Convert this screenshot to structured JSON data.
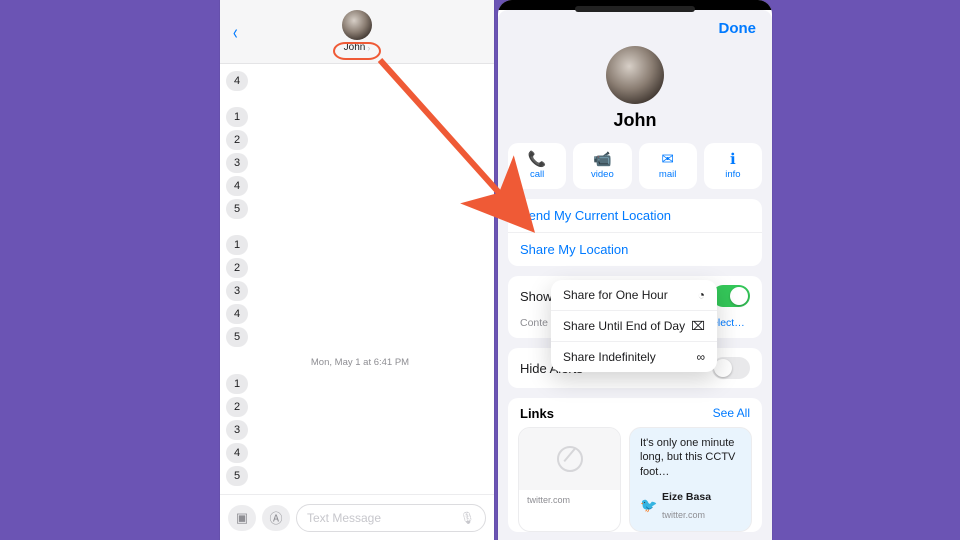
{
  "colors": {
    "accent": "#007aff",
    "annotation": "#ef5a36",
    "toggle_on": "#34c759"
  },
  "left": {
    "contact_name": "John",
    "back_label": "Back",
    "composer_placeholder": "Text Message",
    "timestamp": "Mon, May 1 at 6:41 PM",
    "bubble_groups": [
      [
        "4"
      ],
      [
        "1",
        "2",
        "3",
        "4",
        "5"
      ],
      [
        "1",
        "2",
        "3",
        "4",
        "5"
      ]
    ],
    "bubble_group_after_timestamp": [
      "1",
      "2",
      "3",
      "4",
      "5"
    ]
  },
  "right": {
    "done_label": "Done",
    "contact_name": "John",
    "actions": [
      {
        "id": "call",
        "label": "call",
        "glyph": "📞"
      },
      {
        "id": "video",
        "label": "video",
        "glyph": "📹"
      },
      {
        "id": "mail",
        "label": "mail",
        "glyph": "✉︎"
      },
      {
        "id": "info",
        "label": "info",
        "glyph": "ℹ︎"
      }
    ],
    "location_rows": {
      "send_current": "Send My Current Location",
      "share_my": "Share My Location"
    },
    "show_in_shared": {
      "title_visible_prefix": "Show",
      "description_prefix": "Conte",
      "description_suffix": "n",
      "select_link_suffix": "select…",
      "toggle_on": true
    },
    "hide_alerts": {
      "label": "Hide Alerts",
      "toggle_on": false
    },
    "share_popover": [
      {
        "label": "Share for One Hour",
        "icon": "◔"
      },
      {
        "label": "Share Until End of Day",
        "icon": "⌧"
      },
      {
        "label": "Share Indefinitely",
        "icon": "∞"
      }
    ],
    "links": {
      "header": "Links",
      "see_all": "See All",
      "ghost_source": "twitter.com",
      "tweet_text": "It's only one minute long, but this CCTV foot…",
      "tweet_author": "Eize Basa",
      "tweet_source": "twitter.com"
    }
  }
}
